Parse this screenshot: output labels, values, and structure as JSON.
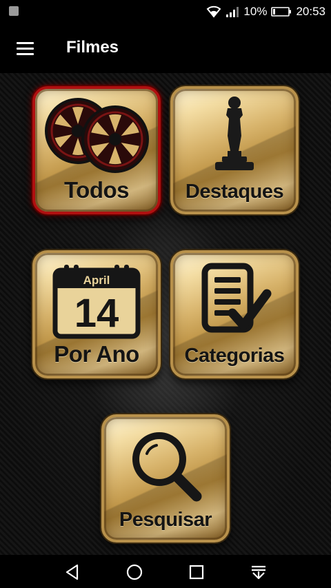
{
  "status_bar": {
    "battery_percent": "10%",
    "time": "20:53",
    "icons": [
      "image-notification-icon",
      "wifi-icon",
      "signal-icon",
      "battery-icon"
    ]
  },
  "app_bar": {
    "title": "Filmes",
    "menu_icon": "hamburger-menu-icon"
  },
  "tiles": [
    {
      "label": "Todos",
      "icon": "film-reels-icon",
      "selected": true
    },
    {
      "label": "Destaques",
      "icon": "oscar-statue-icon",
      "selected": false
    },
    {
      "label": "Por Ano",
      "icon": "calendar-icon",
      "calendar_month": "April",
      "calendar_day": "14",
      "selected": false
    },
    {
      "label": "Categorias",
      "icon": "checklist-icon",
      "selected": false
    },
    {
      "label": "Pesquisar",
      "icon": "magnifier-icon",
      "selected": false
    }
  ],
  "nav_bar": {
    "icons": [
      "back-icon",
      "home-icon",
      "recents-icon",
      "notification-pull-icon"
    ]
  },
  "colors": {
    "background": "#000000",
    "gold": "#d8b46c",
    "active_border": "#b01010",
    "text_dark": "#141414"
  }
}
